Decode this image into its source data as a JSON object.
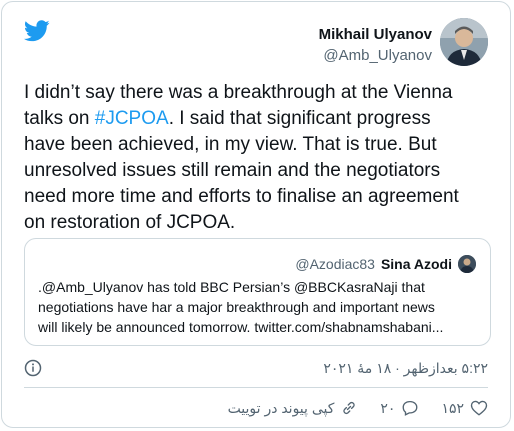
{
  "author": {
    "name": "Mikhail Ulyanov",
    "handle": "@Amb_Ulyanov"
  },
  "tweet": {
    "text_before_hashtag": "I didn’t say there was a breakthrough at the Vienna\ntalks on ",
    "hashtag": "#JCPOA",
    "text_after_hashtag": ". I said that significant progress\nhave been achieved, in my view. That is true. But\nunresolved issues still remain and the negotiators\nneed more time and efforts to finalise an agreement\non restoration of JCPOA."
  },
  "quote": {
    "name": "Sina Azodi",
    "handle": "@Azodiac83",
    "text": ".@Amb_Ulyanov has told BBC Persian’s @BBCKasraNaji that\nnegotiations have har a major breakthrough and important news\nwill likely be announced tomorrow. twitter.com/shabnamshabani..."
  },
  "timestamp": "۵:۲۲ بعدازظهر · ۱۸ مهٔ ۲۰۲۱",
  "actions": {
    "like_count": "۱۵۲",
    "reply_count": "۲۰",
    "copy_link_label": "کپی پیوند در توییت"
  },
  "colors": {
    "accent": "#1d9bf0",
    "text": "#0f1419",
    "muted": "#536471",
    "border": "#cfd9de"
  }
}
